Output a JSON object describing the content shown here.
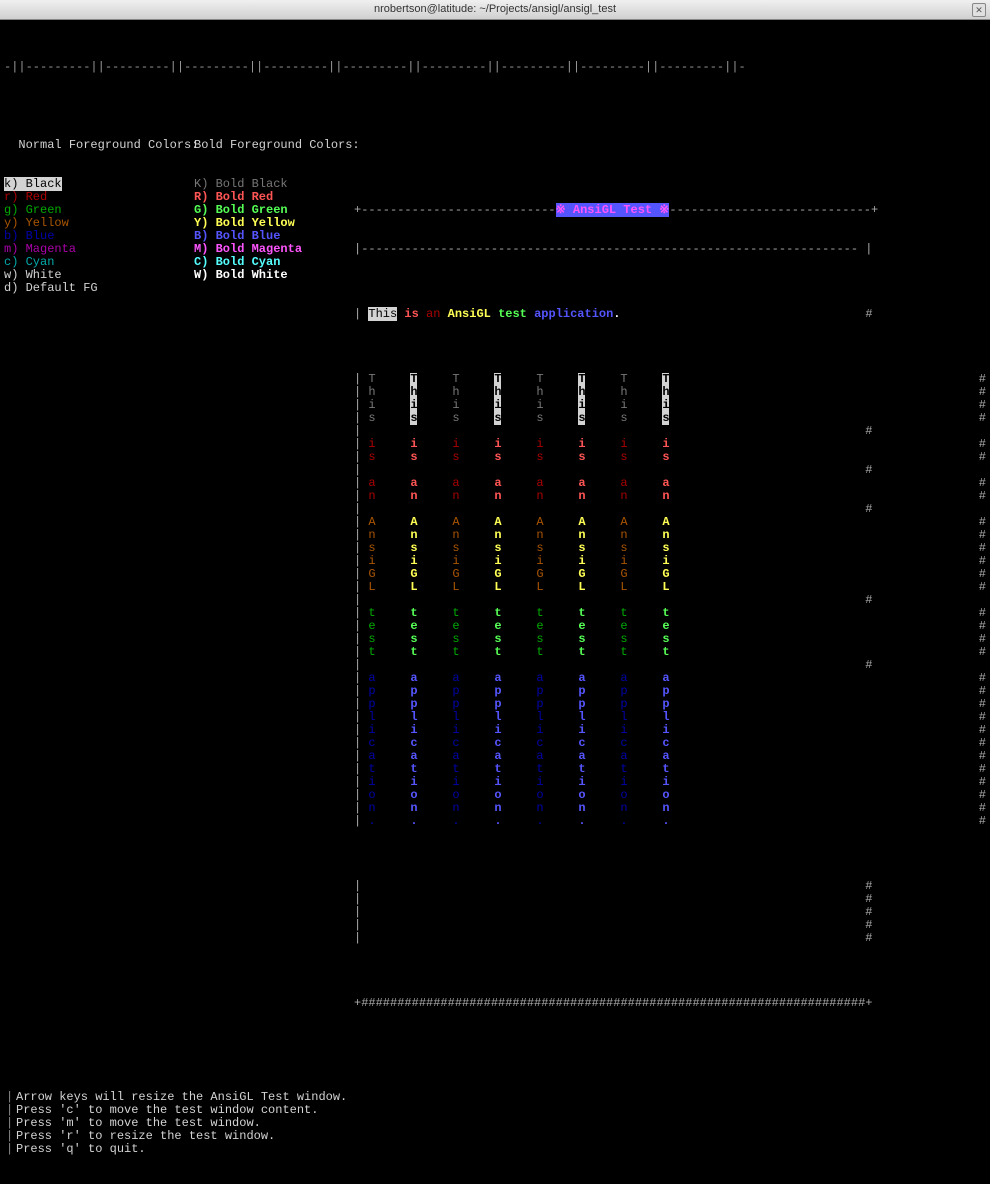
{
  "window": {
    "title": "nrobertson@latitude: ~/Projects/ansigl/ansigl_test"
  },
  "ruler": "-||---------||---------||---------||---------||---------||---------||---------||---------||---------||-",
  "headers": {
    "normal": "Normal Foreground Colors:",
    "bold": "Bold Foreground Colors:"
  },
  "normal_colors": [
    {
      "key": "k",
      "label": "Black",
      "cls": "sel"
    },
    {
      "key": "r",
      "label": "Red",
      "cls": "c-r"
    },
    {
      "key": "g",
      "label": "Green",
      "cls": "c-g"
    },
    {
      "key": "y",
      "label": "Yellow",
      "cls": "c-y"
    },
    {
      "key": "b",
      "label": "Blue",
      "cls": "c-b"
    },
    {
      "key": "m",
      "label": "Magenta",
      "cls": "c-m"
    },
    {
      "key": "c",
      "label": "Cyan",
      "cls": "c-c"
    },
    {
      "key": "w",
      "label": "White",
      "cls": "c-w"
    },
    {
      "key": "d",
      "label": "Default FG",
      "cls": "c-w"
    }
  ],
  "bold_colors": [
    {
      "key": "K",
      "label": "Bold Black",
      "cls": "c-K"
    },
    {
      "key": "R",
      "label": "Bold Red",
      "cls": "c-R"
    },
    {
      "key": "G",
      "label": "Bold Green",
      "cls": "c-G"
    },
    {
      "key": "Y",
      "label": "Bold Yellow",
      "cls": "c-Y"
    },
    {
      "key": "B",
      "label": "Bold Blue",
      "cls": "c-B"
    },
    {
      "key": "M",
      "label": "Bold Magenta",
      "cls": "c-M"
    },
    {
      "key": "C",
      "label": "Bold Cyan",
      "cls": "c-C"
    },
    {
      "key": "W",
      "label": "Bold White",
      "cls": "c-W"
    }
  ],
  "app_title": "※ AnsiGL Test ※",
  "sentence": [
    {
      "text": "This",
      "cls": "inv-this"
    },
    {
      "text": " ",
      "cls": ""
    },
    {
      "text": "is",
      "cls": "c-R"
    },
    {
      "text": " ",
      "cls": ""
    },
    {
      "text": "an",
      "cls": "c-r"
    },
    {
      "text": " ",
      "cls": ""
    },
    {
      "text": "AnsiGL",
      "cls": "c-Y"
    },
    {
      "text": " ",
      "cls": ""
    },
    {
      "text": "test",
      "cls": "c-G"
    },
    {
      "text": " ",
      "cls": ""
    },
    {
      "text": "application",
      "cls": "c-B"
    },
    {
      "text": ".",
      "cls": "c-W"
    }
  ],
  "vertical_words": [
    {
      "text": "This",
      "cls_pair": [
        "c-K",
        "c-W"
      ]
    },
    {
      "text": "is",
      "cls_pair": [
        "c-r",
        "c-R"
      ]
    },
    {
      "text": "an",
      "cls_pair": [
        "c-r",
        "c-R"
      ]
    },
    {
      "text": "AnsiGL",
      "cls_pair": [
        "c-y",
        "c-Y"
      ]
    },
    {
      "text": "test",
      "cls_pair": [
        "c-g",
        "c-G"
      ]
    },
    {
      "text": "application.",
      "cls_pair": [
        "c-b",
        "c-B"
      ]
    }
  ],
  "n_columns": 8,
  "help": [
    "Arrow keys will resize the AnsiGL Test window.",
    "Press 'c' to move the test window content.",
    "Press 'm' to move the test window.",
    "Press 'r' to resize the test window.",
    "Press 'q' to quit."
  ]
}
